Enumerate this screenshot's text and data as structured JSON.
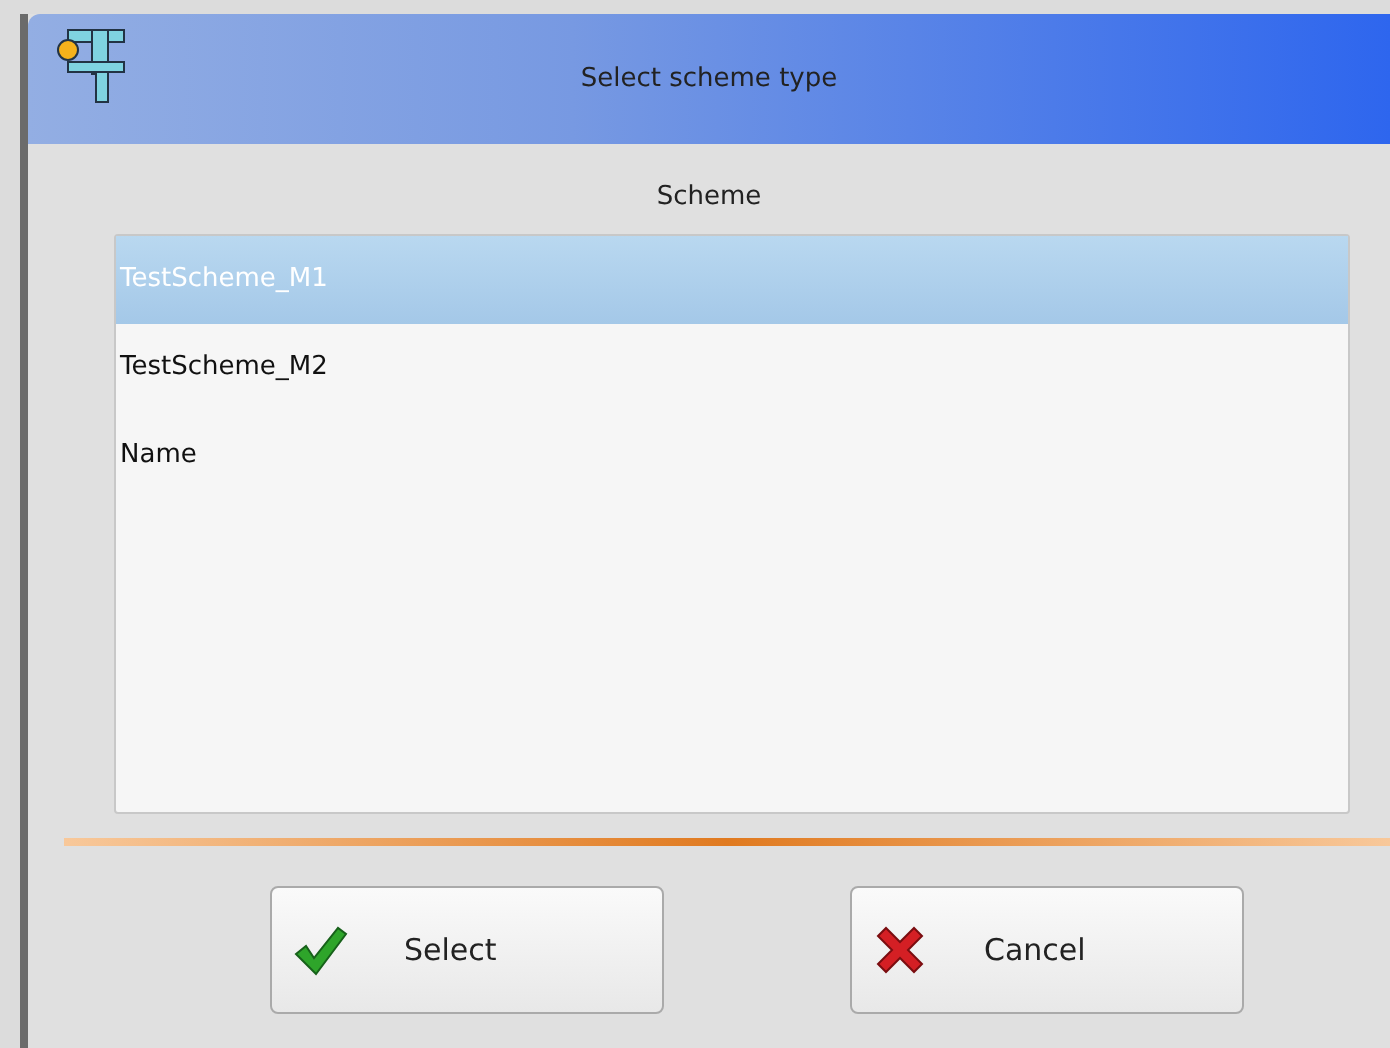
{
  "window": {
    "title": "Select scheme type"
  },
  "list": {
    "header": "Scheme",
    "items": [
      {
        "label": "TestScheme_M1",
        "selected": true
      },
      {
        "label": "TestScheme_M2",
        "selected": false
      },
      {
        "label": "Name",
        "selected": false
      }
    ]
  },
  "buttons": [
    {
      "kind": "confirm",
      "label": "Select"
    },
    {
      "kind": "cancel",
      "label": "Cancel"
    }
  ]
}
